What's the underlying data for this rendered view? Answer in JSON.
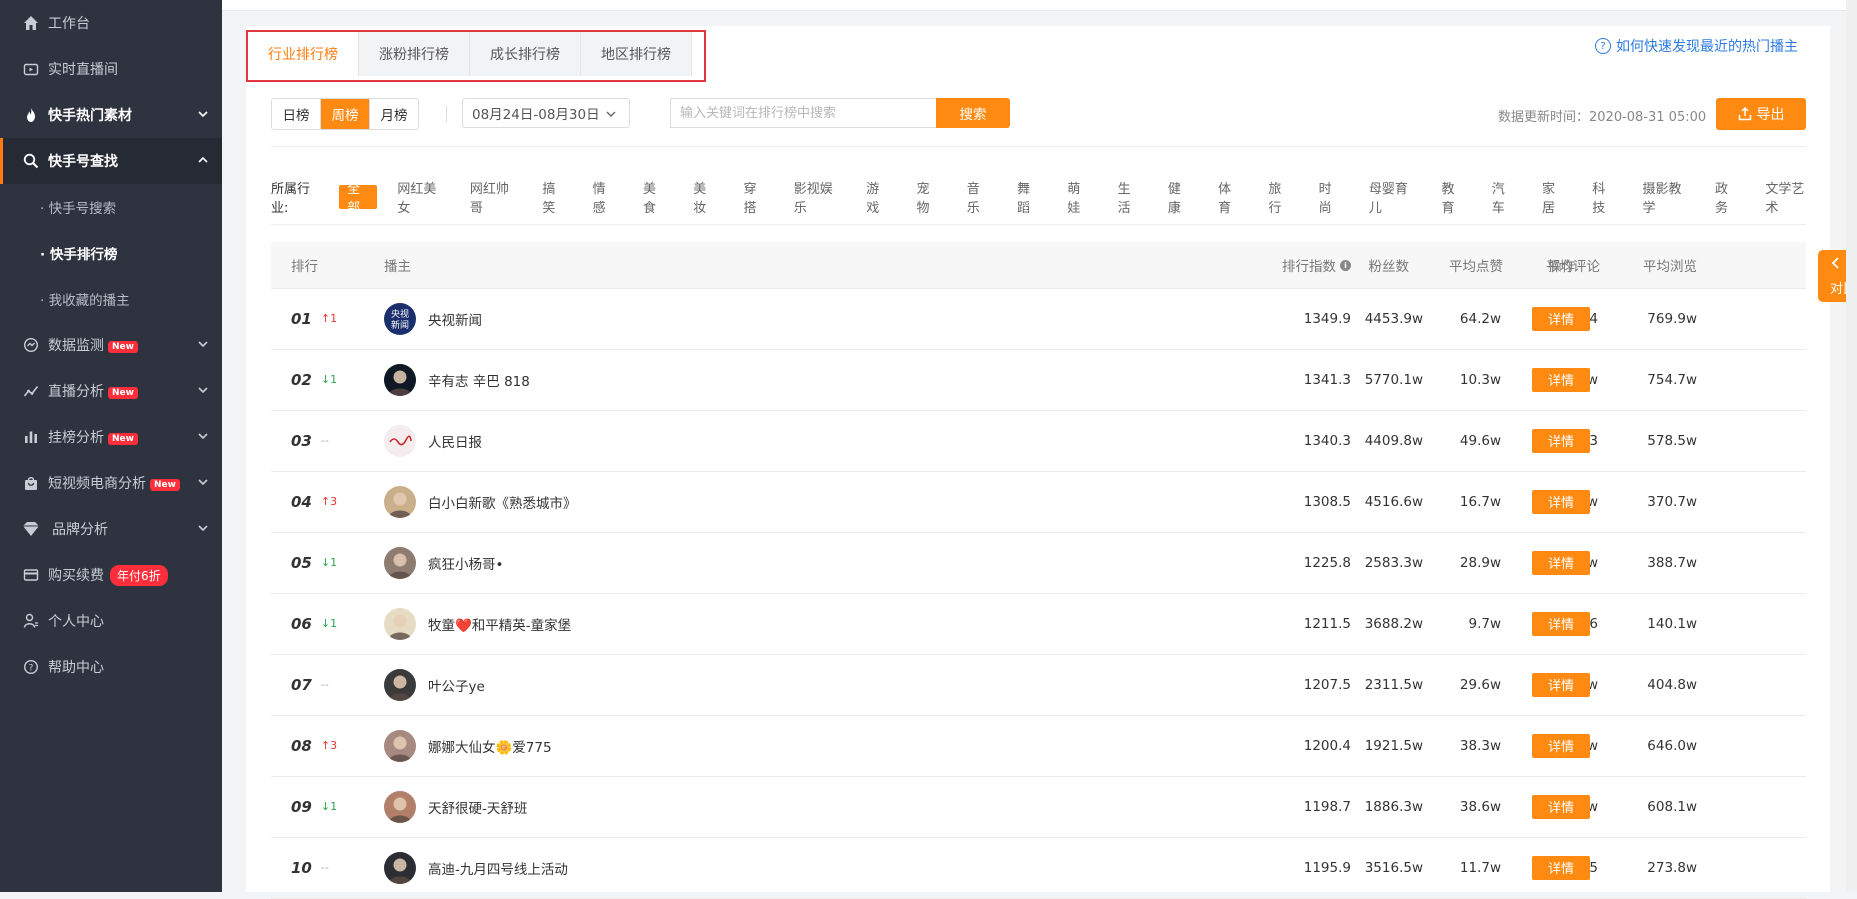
{
  "sidebar": {
    "workbench": "工作台",
    "live_room": "实时直播间",
    "hot_material": "快手热门素材",
    "account_search": "快手号查找",
    "sub_search": "· 快手号搜索",
    "sub_rank": "· 快手排行榜",
    "sub_fav": "· 我收藏的播主",
    "data_monitor": "数据监测",
    "live_analysis": "直播分析",
    "chart_analysis": "挂榜分析",
    "video_ecom": "短视频电商分析",
    "brand": "品牌分析",
    "purchase": "购买续费",
    "purchase_badge": "年付6折",
    "personal": "个人中心",
    "help": "帮助中心",
    "new_badge": "New"
  },
  "tabs": [
    "行业排行榜",
    "涨粉排行榜",
    "成长排行榜",
    "地区排行榜"
  ],
  "help_link": "如何快速发现最近的热门播主",
  "period": [
    "日榜",
    "周榜",
    "月榜"
  ],
  "date_range": "08月24日-08月30日",
  "search": {
    "placeholder": "输入关键词在排行榜中搜索",
    "button": "搜索"
  },
  "update_time": "数据更新时间：2020-08-31 05:00",
  "export_label": "导出",
  "industry_label": "所属行业:",
  "industries": [
    "全部",
    "网红美女",
    "网红帅哥",
    "搞笑",
    "情感",
    "美食",
    "美妆",
    "穿搭",
    "影视娱乐",
    "游戏",
    "宠物",
    "音乐",
    "舞蹈",
    "萌娃",
    "生活",
    "健康",
    "体育",
    "旅行",
    "时尚",
    "母婴育儿",
    "教育",
    "汽车",
    "家居",
    "科技",
    "摄影教学",
    "政务",
    "文学艺术"
  ],
  "table": {
    "headers": {
      "rank": "排行",
      "streamer": "播主",
      "index": "排行指数",
      "fans": "粉丝数",
      "likes": "平均点赞",
      "comments": "平均评论",
      "views": "平均浏览",
      "action": "操作"
    },
    "detail_label": "详情",
    "rows": [
      {
        "rank": "01",
        "trend": "↑1",
        "name": "央视新闻",
        "index": "1349.9",
        "fans": "4453.9w",
        "likes": "64.2w",
        "comments": "8274",
        "views": "769.9w"
      },
      {
        "rank": "02",
        "trend": "↓1",
        "name": "辛有志 辛巴 818",
        "index": "1341.3",
        "fans": "5770.1w",
        "likes": "10.3w",
        "comments": "1.6w",
        "views": "754.7w"
      },
      {
        "rank": "03",
        "trend": "--",
        "name": "人民日报",
        "index": "1340.3",
        "fans": "4409.8w",
        "likes": "49.6w",
        "comments": "6663",
        "views": "578.5w"
      },
      {
        "rank": "04",
        "trend": "↑3",
        "name": "白小白新歌《熟悉城市》",
        "index": "1308.5",
        "fans": "4516.6w",
        "likes": "16.7w",
        "comments": "2.0w",
        "views": "370.7w"
      },
      {
        "rank": "05",
        "trend": "↓1",
        "name": "疯狂小杨哥•",
        "index": "1225.8",
        "fans": "2583.3w",
        "likes": "28.9w",
        "comments": "1.2w",
        "views": "388.7w"
      },
      {
        "rank": "06",
        "trend": "↓1",
        "name": "牧童❤️和平精英-童家堡",
        "index": "1211.5",
        "fans": "3688.2w",
        "likes": "9.7w",
        "comments": "9556",
        "views": "140.1w"
      },
      {
        "rank": "07",
        "trend": "--",
        "name": "叶公子ye",
        "index": "1207.5",
        "fans": "2311.5w",
        "likes": "29.6w",
        "comments": "1.0w",
        "views": "404.8w"
      },
      {
        "rank": "08",
        "trend": "↑3",
        "name": "娜娜大仙女🌼爱775",
        "index": "1200.4",
        "fans": "1921.5w",
        "likes": "38.3w",
        "comments": "9.3w",
        "views": "646.0w"
      },
      {
        "rank": "09",
        "trend": "↓1",
        "name": "天舒很硬-天舒班",
        "index": "1198.7",
        "fans": "1886.3w",
        "likes": "38.6w",
        "comments": "8.0w",
        "views": "608.1w"
      },
      {
        "rank": "10",
        "trend": "--",
        "name": "高迪-九月四号线上活动",
        "index": "1195.9",
        "fans": "3516.5w",
        "likes": "11.7w",
        "comments": "4525",
        "views": "273.8w"
      }
    ]
  },
  "compare_label": "对比",
  "colors": {
    "accent": "#ff8a12",
    "sidebar": "#2f3340",
    "highlight_border": "#e0383e"
  }
}
